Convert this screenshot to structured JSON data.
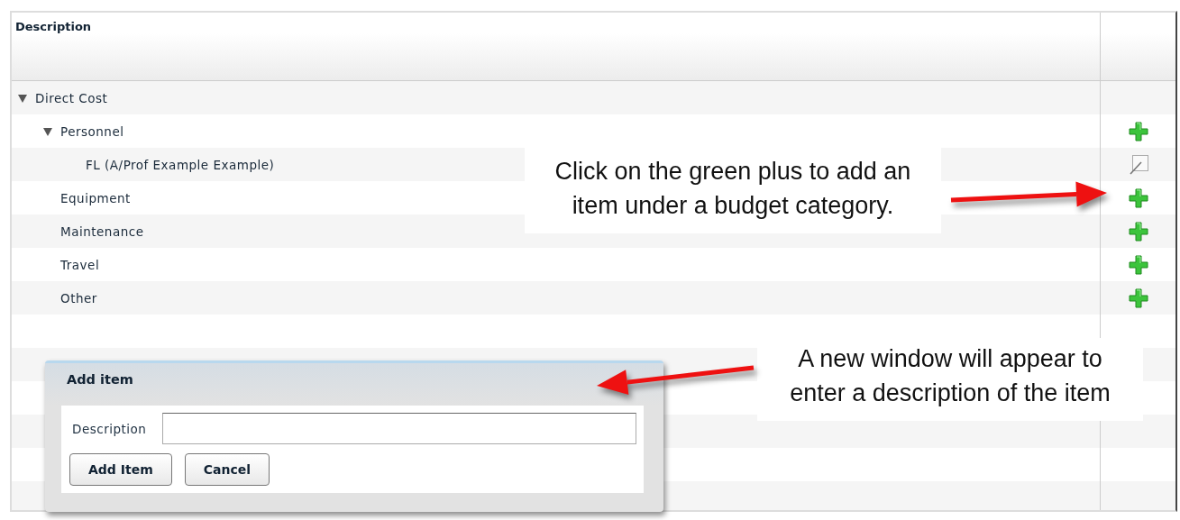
{
  "table": {
    "columns": [
      "Description"
    ],
    "rows": [
      {
        "label": "Direct Cost",
        "expanded": true,
        "children": [
          {
            "label": "Personnel",
            "expanded": true,
            "kind": "add",
            "children": [
              {
                "label": "FL (A/Prof Example Example)",
                "kind": "edit"
              }
            ]
          },
          {
            "label": "Equipment",
            "kind": "add"
          },
          {
            "label": "Maintenance",
            "kind": "add"
          },
          {
            "label": "Travel",
            "kind": "add"
          },
          {
            "label": "Other",
            "kind": "add"
          }
        ]
      }
    ]
  },
  "callouts": [
    {
      "text": "Click on the green plus to add an\nitem under a budget category."
    },
    {
      "text": "A new window will appear to\nenter a description of the item"
    }
  ],
  "dialog": {
    "title": "Add item",
    "fields": [
      {
        "label": "Description"
      }
    ],
    "buttons": [
      "Add Item",
      "Cancel"
    ]
  }
}
